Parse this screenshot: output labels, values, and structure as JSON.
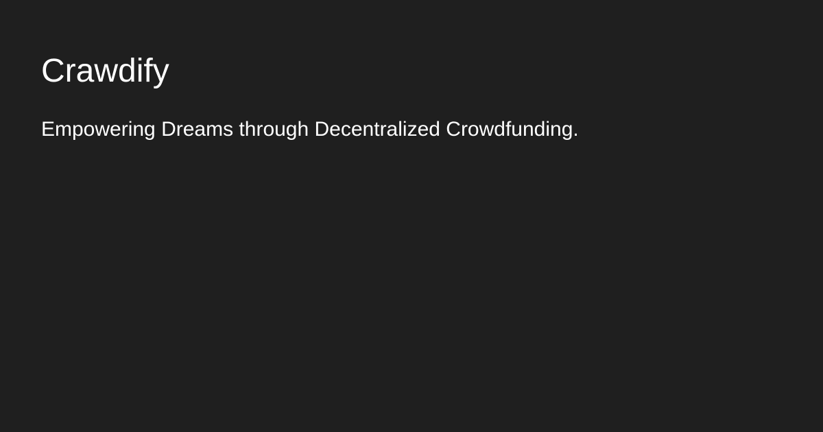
{
  "brand": {
    "name": "Crawdify",
    "tagline": "Empowering Dreams through Decentralized Crowdfunding."
  },
  "colors": {
    "background": "#1f1f1f",
    "text": "#ffffff"
  }
}
